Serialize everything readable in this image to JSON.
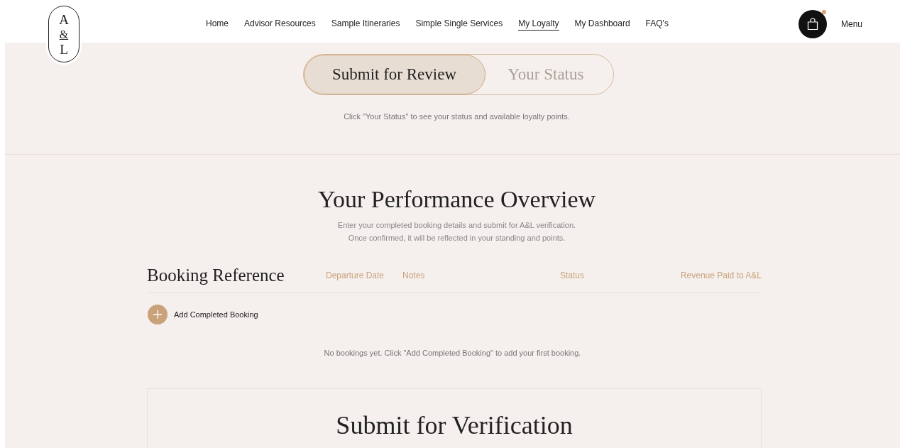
{
  "logo": {
    "letters": [
      "A",
      "&",
      "L"
    ]
  },
  "nav": [
    {
      "label": "Home",
      "selected": false
    },
    {
      "label": "Advisor Resources",
      "selected": false
    },
    {
      "label": "Sample Itineraries",
      "selected": false
    },
    {
      "label": "Simple Single Services",
      "selected": false
    },
    {
      "label": "My Loyalty",
      "selected": true
    },
    {
      "label": "My Dashboard",
      "selected": false
    },
    {
      "label": "FAQ's",
      "selected": false
    }
  ],
  "cart": {
    "has_notification": true
  },
  "menu_label": "Menu",
  "tabs": [
    {
      "label": "Submit for Review",
      "selected": true
    },
    {
      "label": "Your Status",
      "selected": false
    }
  ],
  "tabs_hint": "Click \"Your Status\" to see your status and available loyalty points.",
  "overview": {
    "title": "Your Performance Overview",
    "description": [
      "Enter your completed booking details and submit for A&L verification.",
      "Once confirmed, it will be reflected in your standing and points."
    ]
  },
  "table": {
    "columns": [
      "Booking Reference",
      "Departure Date",
      "Notes",
      "Status",
      "Revenue Paid to A&L"
    ],
    "add_button": "Add Completed Booking",
    "empty_message": "No bookings yet. Click \"Add Completed Booking\" to add your first booking."
  },
  "verification": {
    "title": "Submit for Verification"
  }
}
